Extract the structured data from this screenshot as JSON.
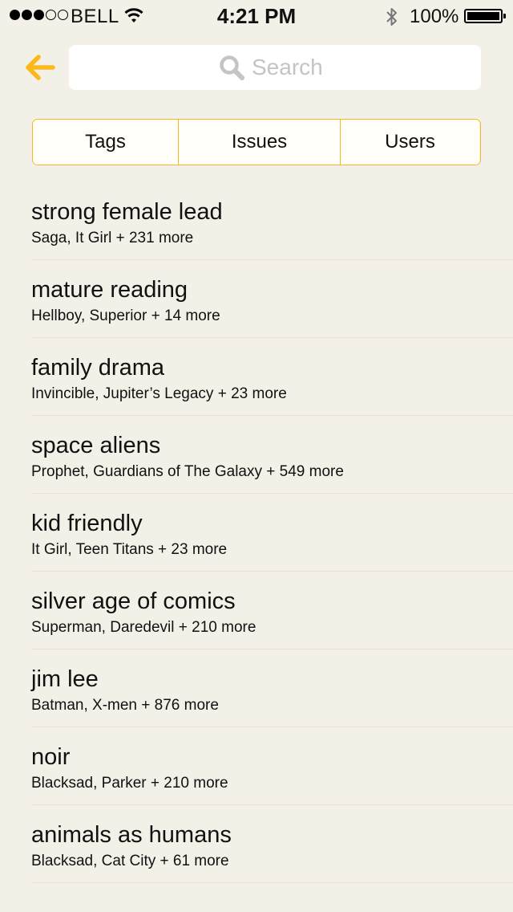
{
  "status_bar": {
    "signal_dots": [
      "full",
      "full",
      "full",
      "empty",
      "empty"
    ],
    "carrier": "BELL",
    "time": "4:21 PM",
    "battery_percent": "100%",
    "battery_level": 1.0
  },
  "header": {
    "back_icon": "arrow-left-icon",
    "search_placeholder": "Search",
    "search_value": ""
  },
  "tabs": [
    {
      "label": "Tags",
      "active": true
    },
    {
      "label": "Issues",
      "active": false
    },
    {
      "label": "Users",
      "active": false
    }
  ],
  "tags": [
    {
      "name": "strong female lead",
      "summary": "Saga, It Girl + 231 more"
    },
    {
      "name": "mature reading",
      "summary": "Hellboy, Superior + 14 more"
    },
    {
      "name": "family drama",
      "summary": "Invincible, Jupiter’s Legacy + 23 more"
    },
    {
      "name": "space aliens",
      "summary": "Prophet, Guardians of The Galaxy + 549 more"
    },
    {
      "name": "kid friendly",
      "summary": "It Girl, Teen Titans + 23 more"
    },
    {
      "name": "silver age of comics",
      "summary": "Superman, Daredevil + 210 more"
    },
    {
      "name": "jim lee",
      "summary": "Batman, X-men + 876 more"
    },
    {
      "name": "noir",
      "summary": "Blacksad, Parker + 210 more"
    },
    {
      "name": "animals as humans",
      "summary": "Blacksad, Cat City + 61 more"
    }
  ],
  "colors": {
    "accent": "#fdb91a",
    "background": "#f3f0e8",
    "divider": "#e6e1cf",
    "placeholder": "#c4c4c4"
  }
}
